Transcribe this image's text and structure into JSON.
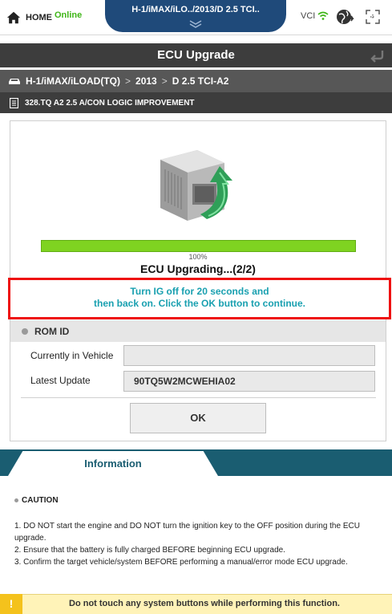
{
  "topbar": {
    "home_label": "HOME",
    "status_label": "Online",
    "vehicle_title": "H-1/iMAX/iLO../2013/D 2.5 TCI..",
    "vci_label": "VCI"
  },
  "title": "ECU Upgrade",
  "breadcrumb": {
    "items": [
      "H-1/iMAX/iLOAD(TQ)",
      "2013",
      "D 2.5 TCI-A2"
    ],
    "separator": ">"
  },
  "subtitle": "328.TQ A2 2.5 A/CON LOGIC IMPROVEMENT",
  "upgrade": {
    "progress_percent": 100,
    "progress_label": "100%",
    "status": "ECU Upgrading...(2/2)",
    "instruction_line1": "Turn IG off for 20 seconds and",
    "instruction_line2": "then back on. Click the OK button to continue."
  },
  "romid": {
    "heading": "ROM ID",
    "current_label": "Currently in Vehicle",
    "current_value": "",
    "latest_label": "Latest Update",
    "latest_value": "90TQ5W2MCWEHIA02"
  },
  "ok_label": "OK",
  "information": {
    "tab_label": "Information",
    "caution_title": "CAUTION",
    "items": [
      "1. DO NOT start the engine and DO NOT turn the ignition key to the OFF position during the ECU upgrade.",
      "2. Ensure that the battery is fully charged BEFORE beginning ECU upgrade.",
      "3. Confirm the target vehicle/system BEFORE performing a manual/error mode ECU upgrade."
    ]
  },
  "warning": {
    "icon": "!",
    "text": "Do not touch any system buttons while performing this function."
  },
  "colors": {
    "title_bar": "#3d3d3d",
    "vehicle_tab": "#1f4a7a",
    "progress": "#7fd321",
    "alert_border": "#ee1010",
    "instruction_text": "#19a0b0",
    "info_strip": "#1a5d71",
    "online": "#3fb618"
  }
}
